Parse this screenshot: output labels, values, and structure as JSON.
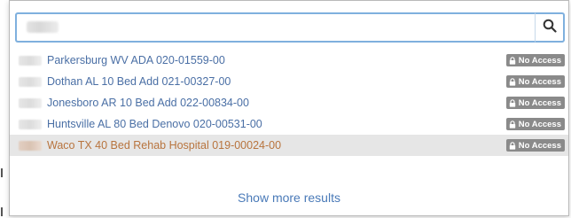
{
  "search": {
    "value": "",
    "query_redacted": true,
    "button_icon": "search-icon"
  },
  "results": [
    {
      "label": "Parkersburg WV ADA  020-01559-00",
      "badge": "No Access",
      "highlighted": false
    },
    {
      "label": "Dothan AL 10 Bed Add  021-00327-00",
      "badge": "No Access",
      "highlighted": false
    },
    {
      "label": "Jonesboro AR 10 Bed Add  022-00834-00",
      "badge": "No Access",
      "highlighted": false
    },
    {
      "label": "Huntsville AL 80 Bed Denovo  020-00531-00",
      "badge": "No Access",
      "highlighted": false
    },
    {
      "label": "Waco TX 40 Bed Rehab Hospital  019-00024-00",
      "badge": "No Access",
      "highlighted": true
    }
  ],
  "footer": {
    "show_more_label": "Show more results"
  },
  "colors": {
    "link": "#4a6fa5",
    "highlight_link": "#b8743e",
    "highlight_bg": "#e6e6e6",
    "badge_bg": "#8a8a8a",
    "focus_border": "#7fb0de"
  }
}
